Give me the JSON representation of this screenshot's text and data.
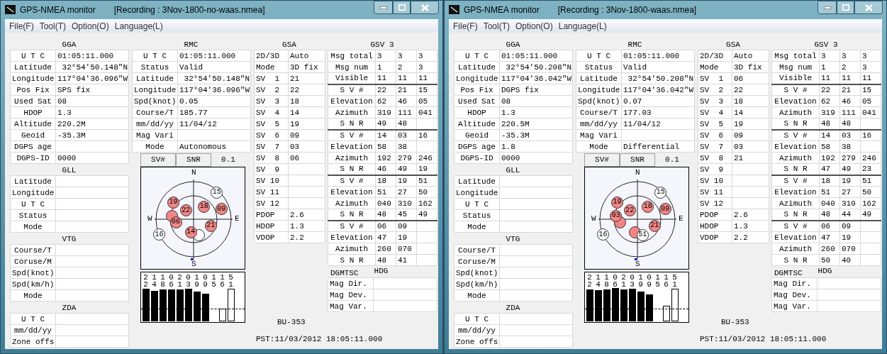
{
  "windows": [
    {
      "title": "GPS-NMEA monitor",
      "recording": "[Recording : 3Nov-1800-no-waas.nmea]",
      "menu": [
        "File(F)",
        "Tool(T)",
        "Option(O)",
        "Language(L)"
      ],
      "gga": {
        "title": "GGA",
        "rows": [
          {
            "label": "U T C",
            "value": "01:05:11.000"
          },
          {
            "label": "Latitude",
            "value": " 32°54'50.148\"N"
          },
          {
            "label": "Longitude",
            "value": "117°04'36.096\"W"
          },
          {
            "label": "Pos Fix",
            "value": "SPS fix"
          },
          {
            "label": "Used Sat",
            "value": "08"
          },
          {
            "label": "HDOP",
            "value": "1.3"
          },
          {
            "label": "Altitude",
            "value": "220.2M"
          },
          {
            "label": "Geoid",
            "value": "-35.3M"
          },
          {
            "label": "DGPS age"
          },
          {
            "label": "DGPS-ID",
            "value": "0000"
          }
        ]
      },
      "gll": {
        "title": "GLL",
        "rows": [
          {
            "label": "Latitude"
          },
          {
            "label": "Longitude"
          },
          {
            "label": "U T C"
          },
          {
            "label": "Status"
          },
          {
            "label": "Mode"
          }
        ]
      },
      "vtg": {
        "title": "VTG",
        "rows": [
          {
            "label": "Course/T"
          },
          {
            "label": "Coruse/M"
          },
          {
            "label": "Spd(knot)"
          },
          {
            "label": "Spd(km/h)"
          },
          {
            "label": "Mode"
          }
        ]
      },
      "zda": {
        "title": "ZDA",
        "rows": [
          {
            "label": "U T C"
          },
          {
            "label": "mm/dd/yy"
          },
          {
            "label": "Zone offs"
          }
        ]
      },
      "rmc": {
        "title": "RMC",
        "rows": [
          {
            "label": "U T C",
            "value": "01:05:11.000"
          },
          {
            "label": "Status",
            "value": "Valid"
          },
          {
            "label": "Latitude",
            "value": " 32°54'50.148\"N"
          },
          {
            "label": "Longitude",
            "value": "117°04'36.096\"W"
          },
          {
            "label": "Spd(knot)",
            "value": "0.05"
          },
          {
            "label": "Course/T",
            "value": "185.77"
          },
          {
            "label": "mm/dd/yy",
            "value": "11/04/12"
          },
          {
            "label": "Mag Vari"
          },
          {
            "label": "Mode",
            "value": "Autonomous"
          }
        ]
      },
      "tabs": [
        {
          "label": "SV#"
        },
        {
          "label": "SNR"
        }
      ],
      "scale_label": "0.1",
      "sky_plot": {
        "north": "N",
        "east": "E",
        "south": "S",
        "west": "W",
        "satellites": [
          {
            "label": "22",
            "used": true
          },
          {
            "label": "21",
            "used": true
          },
          {
            "label": "15",
            "used": false
          },
          {
            "label": "14",
            "used": true,
            "raised": true
          },
          {
            "used": true,
            "raised": false
          },
          {
            "label": "16",
            "used": false
          },
          {
            "label": "18",
            "used": true
          },
          {
            "label": "19",
            "used": true
          },
          {
            "used": false,
            "raised": false
          },
          {
            "label": "06",
            "used": true,
            "raised": true
          },
          {
            "label": "09",
            "used": true
          }
        ]
      },
      "snr_bars": [
        {
          "label": "22",
          "used": true
        },
        {
          "label": "14",
          "used": true
        },
        {
          "label": "18",
          "used": true
        },
        {
          "label": "06",
          "used": true
        },
        {
          "label": "21",
          "used": true
        },
        {
          "label": "03",
          "used": true
        },
        {
          "label": "19",
          "used": true
        },
        {
          "label": "09",
          "used": true
        },
        {
          "label": "15"
        },
        {
          "label": "16",
          "used": false
        },
        {
          "label": "51",
          "used": false
        }
      ],
      "gsa": {
        "title": "GSA",
        "rows": [
          {
            "label": "2D/3D",
            "value": "Auto"
          },
          {
            "label": "Mode",
            "value": "3D fix"
          },
          {
            "label": "SV  1",
            "value": "21"
          },
          {
            "label": "SV  2",
            "value": "22"
          },
          {
            "label": "SV  3",
            "value": "18"
          },
          {
            "label": "SV  4",
            "value": "14"
          },
          {
            "label": "SV  5",
            "value": "19"
          },
          {
            "label": "SV  6",
            "value": "09"
          },
          {
            "label": "SV  7",
            "value": "03"
          },
          {
            "label": "SV  8",
            "value": "06"
          },
          {
            "label": "SV  9"
          },
          {
            "label": "SV 10"
          },
          {
            "label": "SV 11"
          },
          {
            "label": "SV 12"
          },
          {
            "label": "PDOP",
            "value": "2.6"
          },
          {
            "label": "HDOP",
            "value": "1.3"
          },
          {
            "label": "VDOP",
            "value": "2.2"
          }
        ]
      },
      "gsv": {
        "title": "GSV 3",
        "summary": [
          {
            "label": "Msg total",
            "values": [
              "3",
              "3",
              "3"
            ]
          },
          {
            "label": "Msg num",
            "values": [
              "1",
              "2",
              "3"
            ]
          },
          {
            "label": "Visible",
            "values": [
              "11",
              "11",
              "11"
            ]
          }
        ],
        "groups": [
          [
            {
              "label": "S V #",
              "values": [
                "22",
                "21",
                "15"
              ]
            },
            {
              "label": "Elevation",
              "values": [
                "62",
                "46",
                "05"
              ]
            },
            {
              "label": "Azimuth",
              "values": [
                "319",
                "111",
                "041"
              ]
            },
            {
              "label": "S N R",
              "values": [
                "49",
                "48"
              ]
            }
          ],
          [
            {
              "label": "S V #",
              "values": [
                "14",
                "03",
                "16"
              ]
            },
            {
              "label": "Elevation",
              "values": [
                "58",
                "38"
              ]
            },
            {
              "label": "Azimuth",
              "values": [
                "192",
                "279",
                "246"
              ]
            },
            {
              "label": "S N R",
              "values": [
                "46",
                "49",
                "19"
              ]
            }
          ],
          [
            {
              "label": "S V #",
              "values": [
                "18",
                "19",
                "51"
              ]
            },
            {
              "label": "Elevation",
              "values": [
                "51",
                "27",
                "50"
              ]
            },
            {
              "label": "Azimuth",
              "values": [
                "040",
                "310",
                "162"
              ]
            },
            {
              "label": "S N R",
              "values": [
                "48",
                "45",
                "49"
              ]
            }
          ],
          [
            {
              "label": "S V #",
              "values": [
                "06",
                "09"
              ]
            },
            {
              "label": "Elevation",
              "values": [
                "47",
                "19"
              ]
            },
            {
              "label": "Azimuth",
              "values": [
                "260",
                "070"
              ]
            },
            {
              "label": "S N R",
              "values": [
                "48",
                "41"
              ]
            }
          ]
        ]
      },
      "hdg": {
        "titles": [
          "DGMTSC",
          "HDG"
        ],
        "rows": [
          {
            "label": "Mag Dir."
          },
          {
            "label": "Mag Dev."
          },
          {
            "label": "Mag Var."
          }
        ]
      },
      "device": "BU-353",
      "time": "PST:11/03/2012 18:05:11.000"
    },
    {
      "title": "GPS-NMEA monitor",
      "recording": "[Recording : 3Nov-1800-waas.nmea]",
      "menu": [
        "File(F)",
        "Tool(T)",
        "Option(O)",
        "Language(L)"
      ],
      "gga": {
        "title": "GGA",
        "rows": [
          {
            "label": "U T C",
            "value": "01:05:11.000"
          },
          {
            "label": "Latitude",
            "value": " 32°54'50.208\"N"
          },
          {
            "label": "Longitude",
            "value": "117°04'36.042\"W"
          },
          {
            "label": "Pos Fix",
            "value": "DGPS fix"
          },
          {
            "label": "Used Sat",
            "value": "08"
          },
          {
            "label": "HDOP",
            "value": "1.3"
          },
          {
            "label": "Altitude",
            "value": "220.5M"
          },
          {
            "label": "Geoid",
            "value": "-35.3M"
          },
          {
            "label": "DGPS age",
            "value": "1.8"
          },
          {
            "label": "DGPS-ID",
            "value": "0000"
          }
        ]
      },
      "gll": {
        "title": "GLL",
        "rows": [
          {
            "label": "Latitude"
          },
          {
            "label": "Longitude"
          },
          {
            "label": "U T C"
          },
          {
            "label": "Status"
          },
          {
            "label": "Mode"
          }
        ]
      },
      "vtg": {
        "title": "VTG",
        "rows": [
          {
            "label": "Course/T"
          },
          {
            "label": "Coruse/M"
          },
          {
            "label": "Spd(knot)"
          },
          {
            "label": "Spd(km/h)"
          },
          {
            "label": "Mode"
          }
        ]
      },
      "zda": {
        "title": "ZDA",
        "rows": [
          {
            "label": "U T C"
          },
          {
            "label": "mm/dd/yy"
          },
          {
            "label": "Zone offs"
          }
        ]
      },
      "rmc": {
        "title": "RMC",
        "rows": [
          {
            "label": "U T C",
            "value": "01:05:11.000"
          },
          {
            "label": "Status",
            "value": "Valid"
          },
          {
            "label": "Latitude",
            "value": " 32°54'50.208\"N"
          },
          {
            "label": "Longitude",
            "value": "117°04'36.042\"W"
          },
          {
            "label": "Spd(knot)",
            "value": "0.07"
          },
          {
            "label": "Course/T",
            "value": "177.03"
          },
          {
            "label": "mm/dd/yy",
            "value": "11/04/12"
          },
          {
            "label": "Mag Vari"
          },
          {
            "label": "Mode",
            "value": "Differential"
          }
        ]
      },
      "tabs": [
        {
          "label": "SV#"
        },
        {
          "label": "SNR"
        }
      ],
      "scale_label": "0.1",
      "sky_plot": {
        "north": "N",
        "east": "E",
        "south": "S",
        "west": "W",
        "satellites": [
          {
            "label": "22",
            "used": true
          },
          {
            "label": "21",
            "used": true
          },
          {
            "label": "15",
            "used": false
          },
          {
            "used": true,
            "raised": false
          },
          {
            "label": "03",
            "used": true,
            "raised": true
          },
          {
            "label": "16",
            "used": false
          },
          {
            "label": "18",
            "used": true
          },
          {
            "label": "19",
            "used": true
          },
          {
            "label": "51",
            "used": false
          },
          {
            "used": true,
            "raised": false
          },
          {
            "label": "09",
            "used": true
          }
        ]
      },
      "snr_bars": [
        {
          "label": "22",
          "used": true
        },
        {
          "label": "14",
          "used": true
        },
        {
          "label": "18",
          "used": true
        },
        {
          "label": "06",
          "used": true
        },
        {
          "label": "21",
          "used": true
        },
        {
          "label": "03",
          "used": true
        },
        {
          "label": "19",
          "used": true
        },
        {
          "label": "09",
          "used": true
        },
        {
          "label": "15"
        },
        {
          "label": "16",
          "used": false
        },
        {
          "label": "51",
          "used": false
        }
      ],
      "gsa": {
        "title": "GSA",
        "rows": [
          {
            "label": "2D/3D",
            "value": "Auto"
          },
          {
            "label": "Mode",
            "value": "3D fix"
          },
          {
            "label": "SV  1",
            "value": "06"
          },
          {
            "label": "SV  2",
            "value": "22"
          },
          {
            "label": "SV  3",
            "value": "18"
          },
          {
            "label": "SV  4",
            "value": "14"
          },
          {
            "label": "SV  5",
            "value": "19"
          },
          {
            "label": "SV  6",
            "value": "09"
          },
          {
            "label": "SV  7",
            "value": "03"
          },
          {
            "label": "SV  8",
            "value": "21"
          },
          {
            "label": "SV  9"
          },
          {
            "label": "SV 10"
          },
          {
            "label": "SV 11"
          },
          {
            "label": "SV 12"
          },
          {
            "label": "PDOP",
            "value": "2.6"
          },
          {
            "label": "HDOP",
            "value": "1.3"
          },
          {
            "label": "VDOP",
            "value": "2.2"
          }
        ]
      },
      "gsv": {
        "title": "GSV 3",
        "summary": [
          {
            "label": "Msg total",
            "values": [
              "3",
              "3",
              "3"
            ]
          },
          {
            "label": "Msg num",
            "values": [
              "1",
              "2",
              "3"
            ]
          },
          {
            "label": "Visible",
            "values": [
              "11",
              "11",
              "11"
            ]
          }
        ],
        "groups": [
          [
            {
              "label": "S V #",
              "values": [
                "22",
                "21",
                "15"
              ]
            },
            {
              "label": "Elevation",
              "values": [
                "62",
                "46",
                "05"
              ]
            },
            {
              "label": "Azimuth",
              "values": [
                "319",
                "111",
                "041"
              ]
            },
            {
              "label": "S N R",
              "values": [
                "48",
                "48"
              ]
            }
          ],
          [
            {
              "label": "S V #",
              "values": [
                "14",
                "03",
                "16"
              ]
            },
            {
              "label": "Elevation",
              "values": [
                "58",
                "38"
              ]
            },
            {
              "label": "Azimuth",
              "values": [
                "192",
                "279",
                "246"
              ]
            },
            {
              "label": "S N R",
              "values": [
                "47",
                "49",
                "23"
              ]
            }
          ],
          [
            {
              "label": "S V #",
              "values": [
                "18",
                "19",
                "51"
              ]
            },
            {
              "label": "Elevation",
              "values": [
                "51",
                "27",
                "50"
              ]
            },
            {
              "label": "Azimuth",
              "values": [
                "040",
                "310",
                "162"
              ]
            },
            {
              "label": "S N R",
              "values": [
                "48",
                "44",
                "49"
              ]
            }
          ],
          [
            {
              "label": "S V #",
              "values": [
                "06",
                "09"
              ]
            },
            {
              "label": "Elevation",
              "values": [
                "47",
                "19"
              ]
            },
            {
              "label": "Azimuth",
              "values": [
                "260",
                "070"
              ]
            },
            {
              "label": "S N R",
              "values": [
                "50",
                "40"
              ]
            }
          ]
        ]
      },
      "hdg": {
        "titles": [
          "DGMTSC",
          "HDG"
        ],
        "rows": [
          {
            "label": "Mag Dir."
          },
          {
            "label": "Mag Dev."
          },
          {
            "label": "Mag Var."
          }
        ]
      },
      "device": "BU-353",
      "time": "PST:11/03/2012 18:05:11.000"
    }
  ]
}
